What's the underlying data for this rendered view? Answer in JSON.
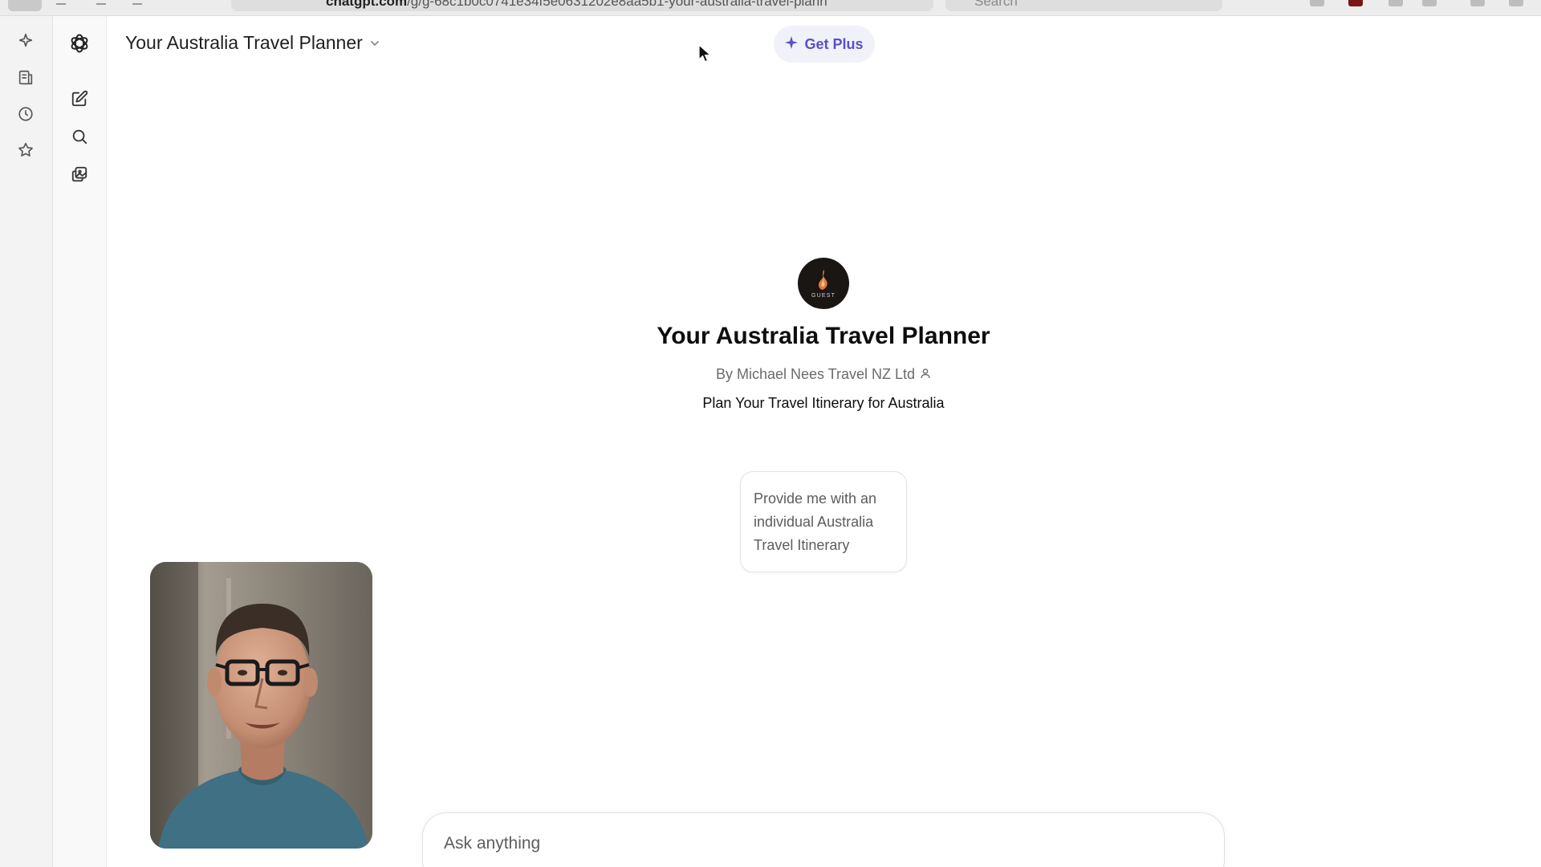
{
  "browser": {
    "url_domain": "chatgpt.com",
    "url_path": "/g/g-68c1b0c0741e34f5e0631202e8aa5b1-your-australia-travel-plann",
    "search_placeholder": "Search"
  },
  "header": {
    "title": "Your Australia Travel Planner",
    "get_plus_label": "Get Plus"
  },
  "gpt": {
    "avatar_text": "GUEST",
    "title": "Your Australia Travel Planner",
    "author": "By Michael Nees Travel NZ Ltd",
    "description": "Plan Your Travel Itinerary for Australia"
  },
  "starters": [
    {
      "label": "Provide me with an individual Australia Travel Itinerary"
    }
  ],
  "composer": {
    "placeholder": "Ask anything"
  },
  "colors": {
    "accent": "#5b4fc6",
    "get_plus_bg": "#f1f1f9",
    "sidebar_bg": "#f9f9f9",
    "browser_side_bg": "#f3f3f3"
  },
  "icons": {
    "browser_side": [
      "sparkle-icon",
      "reading-list-icon",
      "history-icon",
      "bookmark-star-icon"
    ],
    "chat_side": [
      "openai-logo-icon",
      "new-chat-icon",
      "search-icon",
      "library-icon"
    ]
  }
}
